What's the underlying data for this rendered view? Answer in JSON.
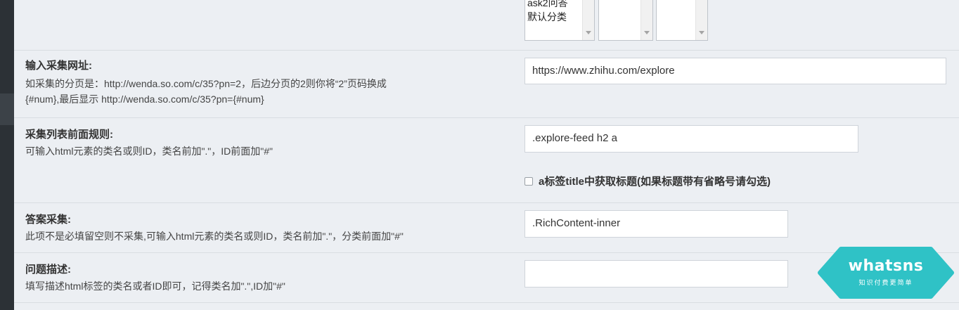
{
  "category_selects": {
    "list1_options": [
      "ask2问答",
      "默认分类"
    ],
    "list2_options": [],
    "list3_options": []
  },
  "fields": {
    "collect_url": {
      "title": "输入采集网址:",
      "hint_line1": "如采集的分页是：http://wenda.so.com/c/35?pn=2，后边分页的2则你将“2”页码换成",
      "hint_line2": "{#num},最后显示 http://wenda.so.com/c/35?pn={#num}",
      "value": "https://www.zhihu.com/explore"
    },
    "list_rule": {
      "title": "采集列表前面规则:",
      "hint": "可输入html元素的类名或则ID，类名前加\".\"，ID前面加\"#\"",
      "value": ".explore-feed h2 a",
      "checkbox_label": "a标签title中获取标题(如果标题带有省略号请勾选)"
    },
    "answer_collect": {
      "title": "答案采集:",
      "hint": "此项不是必填留空则不采集,可输入html元素的类名或则ID，类名前加\".\"，分类前面加\"#\"",
      "value": ".RichContent-inner"
    },
    "question_desc": {
      "title": "问题描述:",
      "hint": "填写描述html标签的类名或者ID即可，记得类名加\".\",ID加\"#\"",
      "value": ""
    }
  },
  "logo": {
    "word": "whatsns",
    "tagline": "知识付费更简单",
    "color": "#2fc2c6"
  }
}
